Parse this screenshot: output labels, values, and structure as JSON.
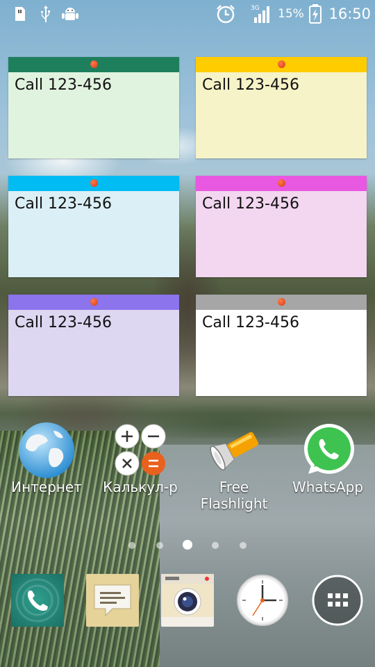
{
  "status_bar": {
    "icons_left": [
      "sd-card-icon",
      "usb-icon",
      "android-debug-icon"
    ],
    "icons_right": [
      "alarm-icon",
      "signal-3g-icon",
      "battery-charging-icon"
    ],
    "network": "3G",
    "battery": "15%",
    "time": "16:50"
  },
  "notes": [
    {
      "text": "Call 123-456",
      "bar": "#1e7f5c",
      "body": "#e0f3df"
    },
    {
      "text": "Call 123-456",
      "bar": "#ffcc00",
      "body": "#f6f3c8"
    },
    {
      "text": "Call 123-456",
      "bar": "#00bcf2",
      "body": "#dbeff7"
    },
    {
      "text": "Call 123-456",
      "bar": "#e858e0",
      "body": "#f3d6f0"
    },
    {
      "text": "Call 123-456",
      "bar": "#8c74ec",
      "body": "#ddd7f2"
    },
    {
      "text": "Call 123-456",
      "bar": "#a6a6a6",
      "body": "#ffffff"
    }
  ],
  "apps": [
    {
      "label": "Интернет",
      "icon": "globe-icon"
    },
    {
      "label": "Калькул-р",
      "icon": "calculator-icon"
    },
    {
      "label": "Free\nFlashlight",
      "label_1": "Free",
      "label_2": "Flashlight",
      "icon": "flashlight-icon"
    },
    {
      "label": "WhatsApp",
      "icon": "whatsapp-icon"
    }
  ],
  "page_indicator": {
    "pages": 5,
    "current": 3
  },
  "dock": [
    {
      "icon": "phone-icon"
    },
    {
      "icon": "messages-icon"
    },
    {
      "icon": "camera-icon"
    },
    {
      "icon": "clock-icon"
    },
    {
      "icon": "app-drawer-icon"
    }
  ]
}
